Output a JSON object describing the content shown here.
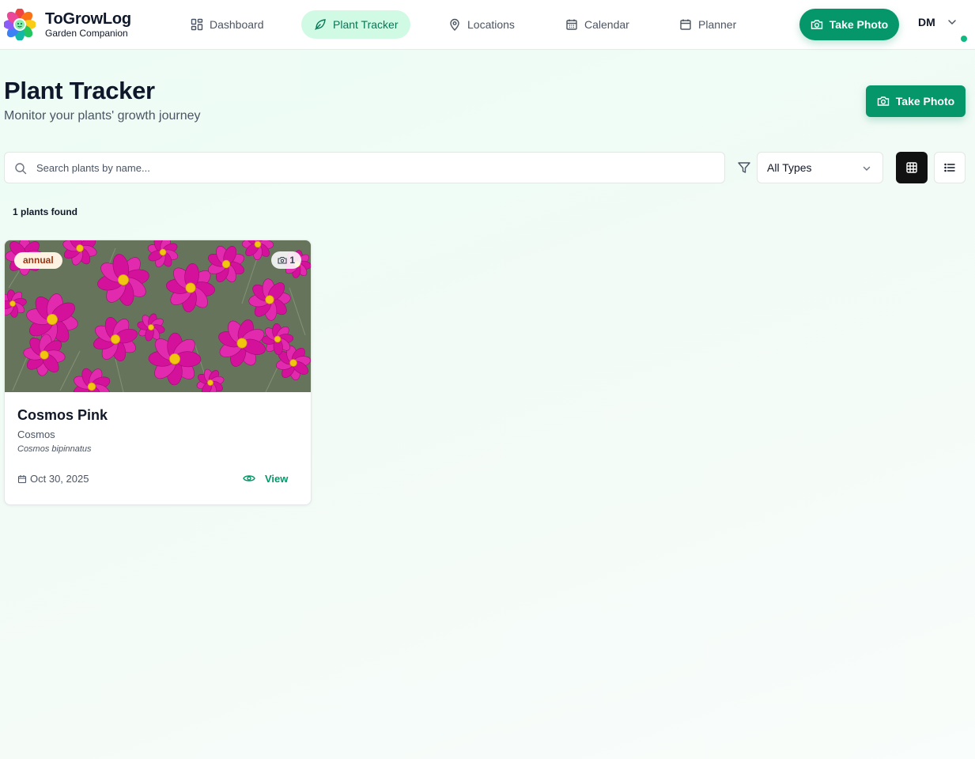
{
  "app": {
    "name": "ToGrowLog",
    "tagline": "Garden Companion"
  },
  "nav": {
    "items": [
      {
        "label": "Dashboard",
        "icon": "layout-grid-icon"
      },
      {
        "label": "Plant Tracker",
        "icon": "leaf-icon",
        "active": true
      },
      {
        "label": "Locations",
        "icon": "map-pin-icon"
      },
      {
        "label": "Calendar",
        "icon": "calendar-icon"
      },
      {
        "label": "Planner",
        "icon": "calendar-icon"
      }
    ]
  },
  "header": {
    "take_photo_label": "Take Photo",
    "user_initials": "DM",
    "status": "online"
  },
  "page": {
    "title": "Plant Tracker",
    "subtitle": "Monitor your plants' growth journey",
    "take_photo_label": "Take Photo"
  },
  "filters": {
    "search_placeholder": "Search plants by name...",
    "search_value": "",
    "type_selected": "All Types",
    "view_mode": "grid"
  },
  "results": {
    "count_text": "1 plants found"
  },
  "plants": [
    {
      "type_badge": "annual",
      "photo_count": "1",
      "name": "Cosmos Pink",
      "common_name": "Cosmos",
      "scientific_name": "Cosmos bipinnatus",
      "date": "Oct 30, 2025",
      "view_label": "View"
    }
  ],
  "colors": {
    "brand_green": "#059669",
    "active_nav_bg": "#d1fae5",
    "active_nav_text": "#047857",
    "badge_bg": "#fef3e2",
    "badge_text": "#9a3412",
    "flower_magenta": "#d3119a"
  }
}
